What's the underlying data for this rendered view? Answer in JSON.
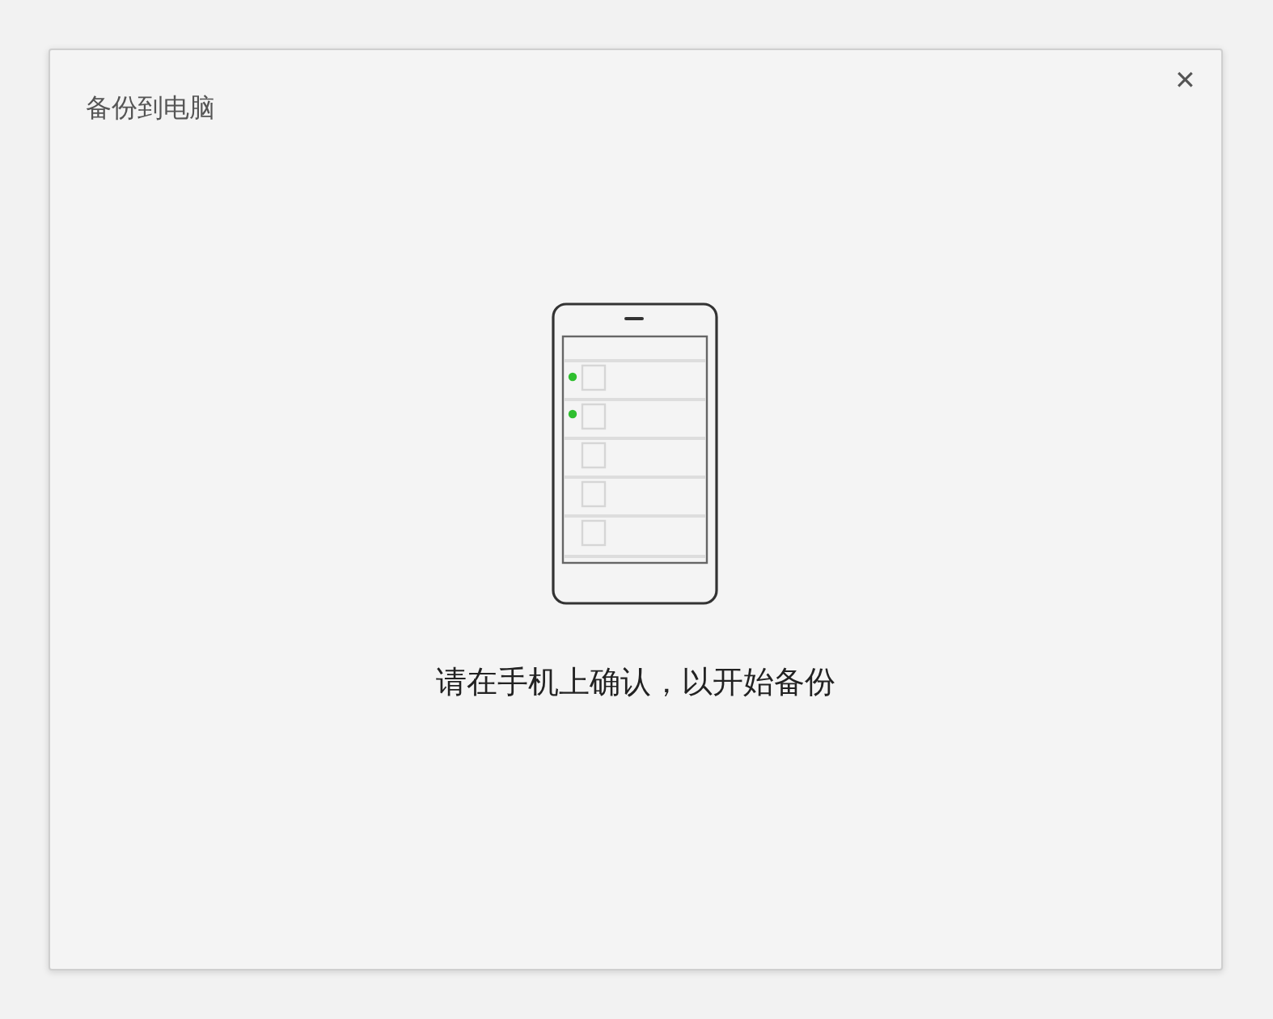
{
  "dialog": {
    "title": "备份到电脑",
    "close": "✕",
    "message": "请在手机上确认，以开始备份"
  }
}
